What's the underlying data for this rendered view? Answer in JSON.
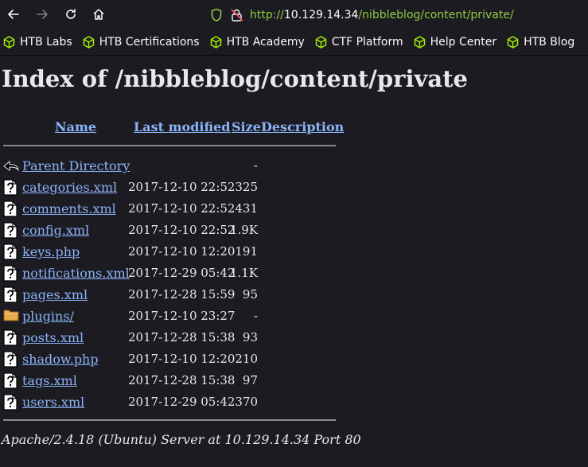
{
  "browser": {
    "url_scheme": "http://",
    "url_host": "10.129.14.34",
    "url_path": "/nibbleblog/content/private/",
    "bookmarks": [
      "HTB Labs",
      "HTB Certifications",
      "HTB Academy",
      "CTF Platform",
      "Help Center",
      "HTB Blog"
    ]
  },
  "page": {
    "title": "Index of /nibbleblog/content/private",
    "columns": {
      "name": "Name",
      "modified": "Last modified",
      "size": "Size",
      "description": "Description"
    },
    "entries": [
      {
        "name": "Parent Directory",
        "modified": "",
        "size": "-",
        "icon": "back-icon"
      },
      {
        "name": "categories.xml",
        "modified": "2017-12-10 22:52",
        "size": "325",
        "icon": "unknown-file-icon"
      },
      {
        "name": "comments.xml",
        "modified": "2017-12-10 22:52",
        "size": "431",
        "icon": "unknown-file-icon"
      },
      {
        "name": "config.xml",
        "modified": "2017-12-10 22:52",
        "size": "1.9K",
        "icon": "unknown-file-icon"
      },
      {
        "name": "keys.php",
        "modified": "2017-12-10 12:20",
        "size": "191",
        "icon": "unknown-file-icon"
      },
      {
        "name": "notifications.xml",
        "modified": "2017-12-29 05:42",
        "size": "1.1K",
        "icon": "unknown-file-icon"
      },
      {
        "name": "pages.xml",
        "modified": "2017-12-28 15:59",
        "size": "95",
        "icon": "unknown-file-icon"
      },
      {
        "name": "plugins/",
        "modified": "2017-12-10 23:27",
        "size": "-",
        "icon": "folder-icon"
      },
      {
        "name": "posts.xml",
        "modified": "2017-12-28 15:38",
        "size": "93",
        "icon": "unknown-file-icon"
      },
      {
        "name": "shadow.php",
        "modified": "2017-12-10 12:20",
        "size": "210",
        "icon": "unknown-file-icon"
      },
      {
        "name": "tags.xml",
        "modified": "2017-12-28 15:38",
        "size": "97",
        "icon": "unknown-file-icon"
      },
      {
        "name": "users.xml",
        "modified": "2017-12-29 05:42",
        "size": "370",
        "icon": "unknown-file-icon"
      }
    ],
    "footer": "Apache/2.4.18 (Ubuntu) Server at 10.129.14.34 Port 80"
  },
  "colors": {
    "link": "#8ab4f8",
    "background": "#1c1b22",
    "htb_green": "#9fef00"
  }
}
